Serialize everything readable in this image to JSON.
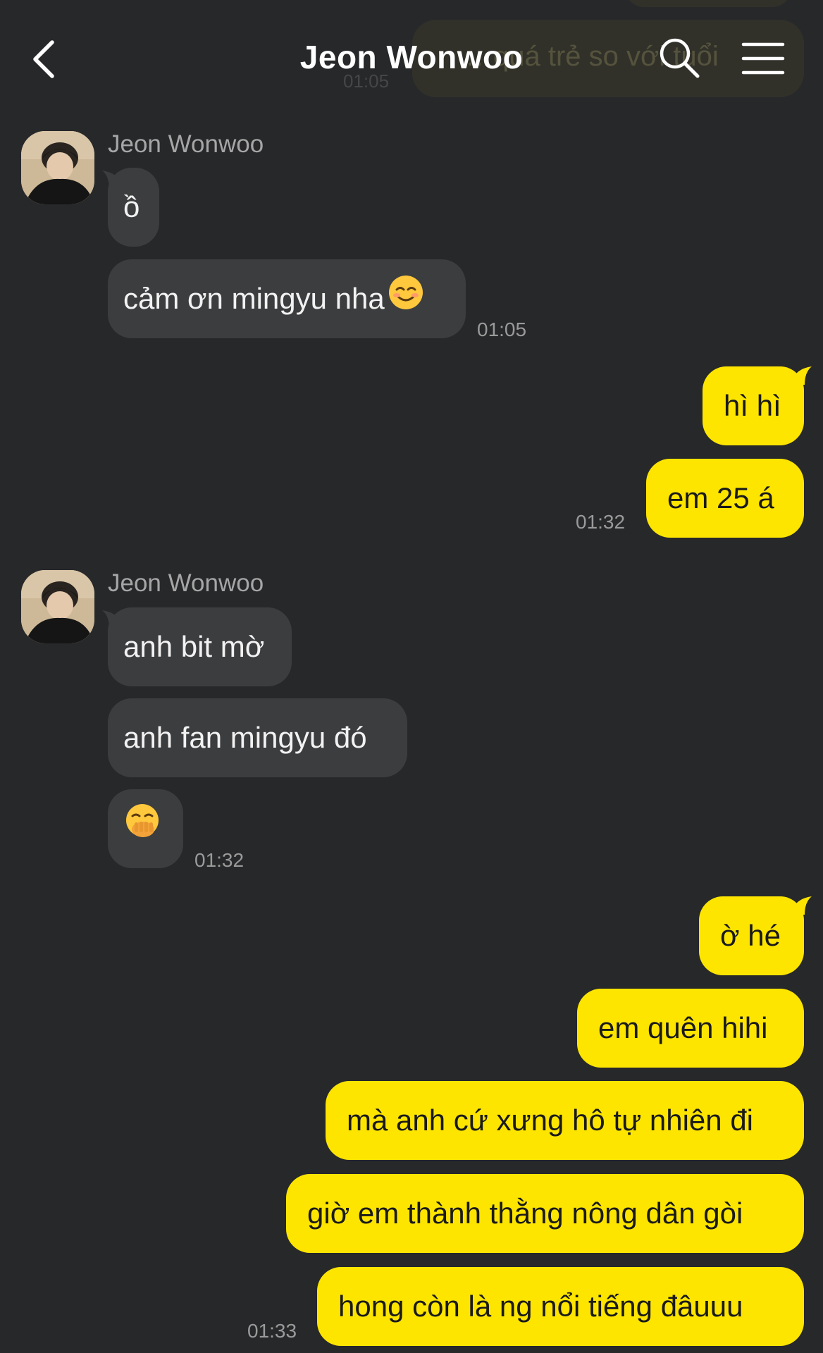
{
  "header": {
    "title": "Jeon Wonwoo",
    "background_preview": {
      "text": "…quá trẻ so với tuổi",
      "time": "01:05"
    }
  },
  "colors": {
    "background": "#27282a",
    "incoming_bubble": "#3c3d3f",
    "outgoing_bubble": "#fee500",
    "timestamp": "#9a9a9a"
  },
  "messages": {
    "g1": {
      "sender": "Jeon Wonwoo",
      "m1": "ồ",
      "m2": "cảm ơn mingyu nha",
      "m2_emoji": "smiling-face-icon",
      "time": "01:05"
    },
    "g2": {
      "m1": "hì hì",
      "m2": "em 25 á",
      "time": "01:32"
    },
    "g3": {
      "sender": "Jeon Wonwoo",
      "m1": "anh bit mờ",
      "m2": "anh fan mingyu đó",
      "m3_emoji": "hand-over-mouth-icon",
      "time": "01:32"
    },
    "g4": {
      "m1": "ờ hé",
      "m2": "em quên hihi",
      "m3": "mà anh cứ xưng hô tự nhiên đi",
      "m4": "giờ em thành thằng nông dân gòi",
      "m5": "hong còn là ng nổi tiếng đâuuu",
      "time": "01:33"
    }
  }
}
